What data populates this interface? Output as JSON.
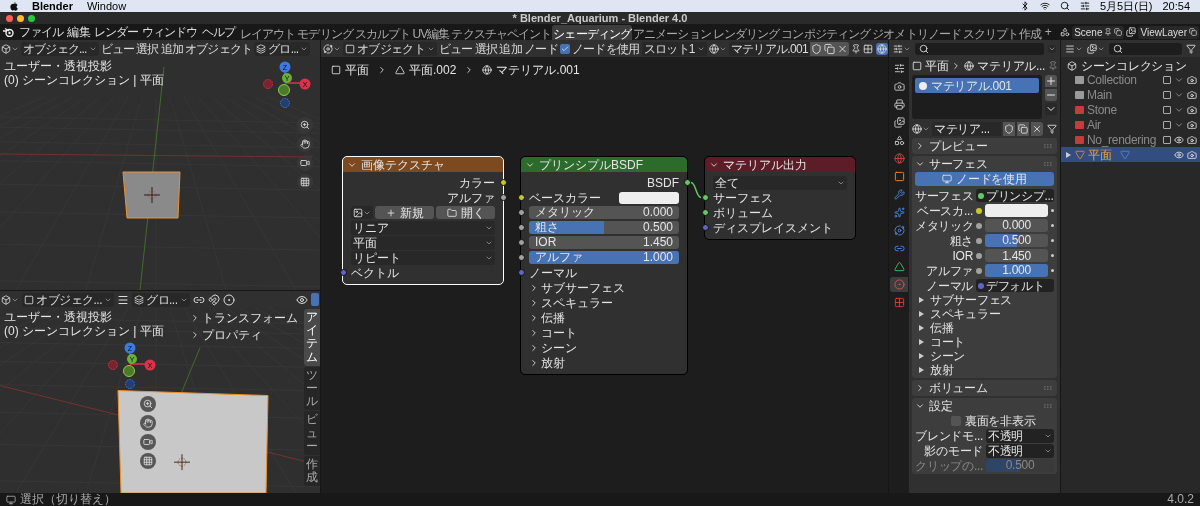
{
  "mac_menubar": {
    "app": "Blender",
    "menus": [
      "Window"
    ],
    "date": "5月5日(日)",
    "time": "20:54"
  },
  "window": {
    "title": "* Blender_Aquarium - Blender 4.0"
  },
  "topbar": {
    "menus": [
      "ファイル",
      "編集",
      "レンダー",
      "ウィンドウ",
      "ヘルプ"
    ],
    "workspaces": [
      {
        "label": "レイアウト",
        "selected": false
      },
      {
        "label": "モデリング",
        "selected": false
      },
      {
        "label": "スカルプト",
        "selected": false
      },
      {
        "label": "UV編集",
        "selected": false
      },
      {
        "label": "テクスチャペイント",
        "selected": false
      },
      {
        "label": "シェーディング",
        "selected": true
      },
      {
        "label": "アニメーション",
        "selected": false
      },
      {
        "label": "レンダリング",
        "selected": false
      },
      {
        "label": "コンポジティング",
        "selected": false
      },
      {
        "label": "ジオメトリノード",
        "selected": false
      },
      {
        "label": "スクリプト作成",
        "selected": false
      }
    ],
    "add_tab": "+",
    "scene": "Scene",
    "view_layer": "ViewLayer"
  },
  "viewport_top": {
    "mode": "オブジェク...",
    "menus": [
      "ビュー",
      "選択",
      "追加",
      "オブジェクト"
    ],
    "orientation": "グロ...",
    "view_name": "ユーザー・透視投影",
    "collection_info": "(0) シーンコレクション | 平面",
    "gizmo": [
      "Z",
      "Y",
      "X"
    ]
  },
  "viewport_bottom": {
    "mode": "オブジェク...",
    "orientation": "グロ...",
    "view_name": "ユーザー・透視投影",
    "collection_info": "(0) シーンコレクション | 平面",
    "gizmo": [
      "Z",
      "Y",
      "X"
    ],
    "panels": [
      {
        "label": "トランスフォーム",
        "expanded": false
      },
      {
        "label": "プロパティ",
        "expanded": false
      }
    ],
    "tabs": [
      {
        "label": "アイテム",
        "selected": true
      },
      {
        "label": "ツール",
        "selected": false
      },
      {
        "label": "ビュー",
        "selected": false
      },
      {
        "label": "作成",
        "selected": false
      }
    ]
  },
  "node_editor": {
    "object_mode": "オブジェクト",
    "menus": [
      "ビュー",
      "選択",
      "追加",
      "ノード"
    ],
    "use_nodes": {
      "label": "ノードを使用",
      "checked": true
    },
    "slot": "スロット1",
    "material": "マテリアル.001",
    "breadcrumbs": [
      "平面",
      "平面.002",
      "マテリアル.001"
    ],
    "nodes": [
      {
        "title": "画像テクスチャ",
        "color": "#7d4a1f",
        "selected": true,
        "rows": [
          {
            "kind": "output",
            "label": "カラー",
            "color": "#c7c729"
          },
          {
            "kind": "output",
            "label": "アルファ",
            "color": "#a1a1a1"
          },
          {
            "kind": "image_buttons",
            "new": "新規",
            "open": "開く"
          },
          {
            "kind": "dropdown",
            "value": "リニア"
          },
          {
            "kind": "dropdown",
            "value": "平面"
          },
          {
            "kind": "dropdown",
            "value": "リピート"
          },
          {
            "kind": "input",
            "label": "ベクトル",
            "color": "#6363c7"
          }
        ]
      },
      {
        "title": "プリンシプルBSDF",
        "color": "#2d6b2d",
        "selected": false,
        "rows": [
          {
            "kind": "output",
            "label": "BSDF",
            "color": "#63c763"
          },
          {
            "kind": "color",
            "label": "ベースカラー",
            "color": "#c7c729",
            "swatch": {
              "color": "#eeeeee"
            }
          },
          {
            "kind": "slider",
            "label": "メタリック",
            "value": "0.000",
            "level": 0,
            "color": "#a1a1a1"
          },
          {
            "kind": "slider",
            "label": "粗さ",
            "value": "0.500",
            "level": 0.5,
            "color": "#a1a1a1"
          },
          {
            "kind": "number",
            "label": "IOR",
            "value": "1.450",
            "color": "#a1a1a1"
          },
          {
            "kind": "slider",
            "label": "アルファ",
            "value": "1.000",
            "level": 1,
            "color": "#a1a1a1"
          },
          {
            "kind": "input",
            "label": "ノーマル",
            "color": "#6363c7"
          },
          {
            "kind": "panel",
            "label": "サブサーフェス"
          },
          {
            "kind": "panel",
            "label": "スペキュラー"
          },
          {
            "kind": "panel",
            "label": "伝播"
          },
          {
            "kind": "panel",
            "label": "コート"
          },
          {
            "kind": "panel",
            "label": "シーン"
          },
          {
            "kind": "panel",
            "label": "放射"
          }
        ]
      },
      {
        "title": "マテリアル出力",
        "color": "#5c1d28",
        "selected": false,
        "rows": [
          {
            "kind": "dropdown",
            "value": "全て"
          },
          {
            "kind": "input",
            "label": "サーフェス",
            "color": "#63c763"
          },
          {
            "kind": "input",
            "label": "ボリューム",
            "color": "#63c763"
          },
          {
            "kind": "input",
            "label": "ディスプレイスメント",
            "color": "#6363c7"
          }
        ]
      }
    ]
  },
  "properties": {
    "tabs": [
      {
        "selected": false
      },
      {
        "selected": false
      },
      {
        "selected": false
      },
      {
        "selected": false
      },
      {
        "selected": false
      },
      {
        "selected": false
      },
      {
        "selected": false
      },
      {
        "selected": false
      },
      {
        "selected": false
      },
      {
        "selected": false
      },
      {
        "selected": false
      },
      {
        "selected": false
      },
      {
        "selected": true
      },
      {
        "selected": false
      }
    ],
    "breadcrumbs": [
      "平面",
      "マテリアル..."
    ],
    "material_slots": [
      {
        "label": "マテリアル.001",
        "selected": true
      }
    ],
    "material": "マテリア...",
    "sections": [
      {
        "title": "プレビュー",
        "expanded": false
      },
      {
        "title": "サーフェス",
        "expanded": true,
        "button": "ノードを使用",
        "rows": [
          {
            "kind": "link",
            "label": "サーフェス",
            "value": "プリンシプ...",
            "color": "#63c763"
          },
          {
            "kind": "color",
            "label": "ベースカ...",
            "color": "#c7c729",
            "swatch": {
              "color": "#eeeeee"
            }
          },
          {
            "kind": "slider",
            "label": "メタリック",
            "value": "0.000",
            "level": 0,
            "color": "#a1a1a1"
          },
          {
            "kind": "slider",
            "label": "粗さ",
            "value": "0.500",
            "level": 0.5,
            "color": "#a1a1a1"
          },
          {
            "kind": "number",
            "label": "IOR",
            "value": "1.450",
            "color": "#a1a1a1"
          },
          {
            "kind": "slider",
            "label": "アルファ",
            "value": "1.000",
            "level": 1,
            "color": "#a1a1a1"
          },
          {
            "kind": "link",
            "label": "ノーマル",
            "value": "デフォルト",
            "color": "#6363c7"
          }
        ],
        "subpanels": [
          "サブサーフェス",
          "スペキュラー",
          "伝播",
          "コート",
          "シーン",
          "放射"
        ]
      },
      {
        "title": "ボリューム",
        "expanded": false
      },
      {
        "title": "設定",
        "expanded": true,
        "settings": [
          {
            "kind": "checkbox",
            "label": "裏面を非表示",
            "checked": false
          },
          {
            "kind": "dropdown",
            "label": "ブレンドモ...",
            "value": "不透明"
          },
          {
            "kind": "dropdown",
            "label": "影のモード",
            "value": "不透明"
          },
          {
            "kind": "slider",
            "label": "クリップの...",
            "value": "0.500",
            "level": 0.5,
            "disabled": true
          }
        ]
      }
    ]
  },
  "outliner": {
    "root": {
      "label": "シーンコレクション",
      "children": [
        {
          "kind": "collection",
          "label": "Collection",
          "color": "#9a9a9a",
          "checked": false,
          "visible": false,
          "selected": false
        },
        {
          "kind": "collection",
          "label": "Main",
          "color": "#9a9a9a",
          "checked": false,
          "visible": false,
          "selected": false
        },
        {
          "kind": "collection",
          "label": "Stone",
          "color": "#c43c3c",
          "checked": false,
          "visible": false,
          "selected": false
        },
        {
          "kind": "collection",
          "label": "Air",
          "color": "#c43c3c",
          "checked": false,
          "visible": false,
          "selected": false
        },
        {
          "kind": "collection",
          "label": "No_rendering",
          "color": "#c43c3c",
          "checked": false,
          "visible": true,
          "selected": false
        },
        {
          "kind": "object",
          "label": "平面",
          "visible": true,
          "selected": true
        }
      ]
    }
  },
  "status_bar": {
    "hint": "選択（切り替え）",
    "version": "4.0.2"
  }
}
